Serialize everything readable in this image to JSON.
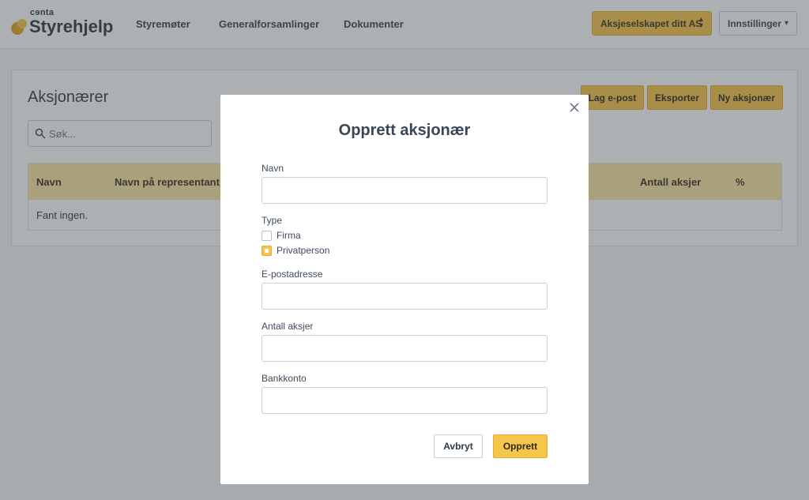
{
  "header": {
    "logo_small": "cɘnta",
    "logo_big": "Styrehjelp",
    "nav": [
      "Styremøter",
      "Generalforsamlinger",
      "Dokumenter"
    ],
    "company_select": "Aksjeselskapet ditt AS",
    "settings_label": "Innstillinger"
  },
  "page": {
    "title": "Aksjonærer",
    "search_placeholder": "Søk...",
    "actions": {
      "email": "Lag e-post",
      "export": "Eksporter",
      "new": "Ny aksjonær"
    },
    "table": {
      "headers": {
        "name": "Navn",
        "representative": "Navn på representant",
        "shares": "Antall aksjer",
        "percent": "%"
      },
      "empty_text": "Fant ingen."
    }
  },
  "modal": {
    "title": "Opprett aksjonær",
    "fields": {
      "name_label": "Navn",
      "name_value": "",
      "type_label": "Type",
      "type_options": [
        {
          "label": "Firma",
          "selected": false
        },
        {
          "label": "Privatperson",
          "selected": true
        }
      ],
      "email_label": "E-postadresse",
      "email_value": "",
      "shares_label": "Antall aksjer",
      "shares_value": "",
      "bank_label": "Bankkonto",
      "bank_value": ""
    },
    "cancel_label": "Avbryt",
    "create_label": "Opprett"
  },
  "colors": {
    "accent": "#f6c54b",
    "table_header": "#fbe3a3",
    "overlay": "rgba(60,66,72,0.42)"
  },
  "icons": [
    "search-icon",
    "chevron-updown-icon",
    "chevron-down-icon",
    "close-icon"
  ]
}
